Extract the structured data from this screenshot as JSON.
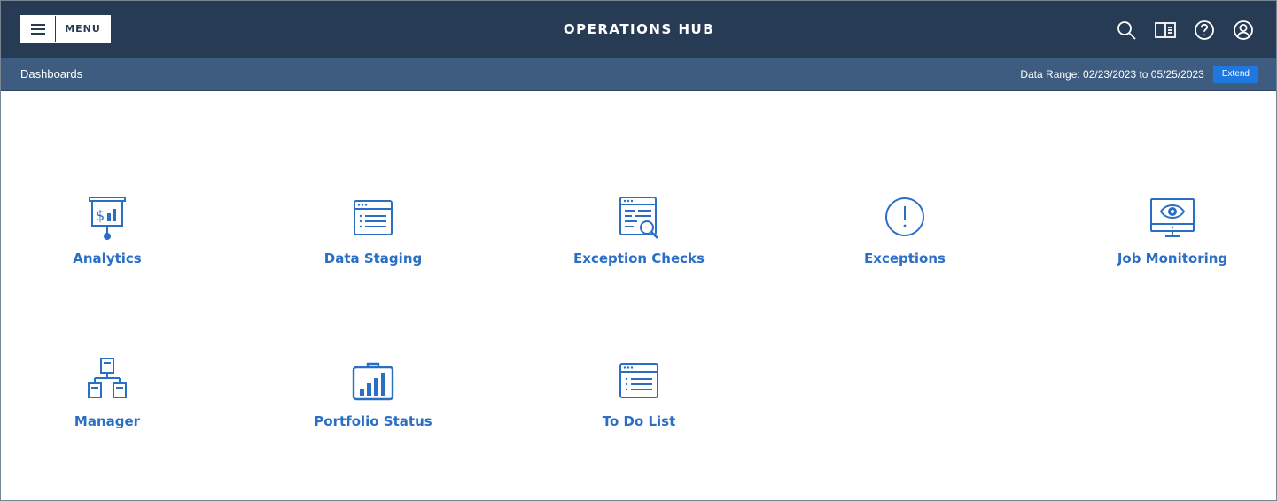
{
  "header": {
    "menu_label": "MENU",
    "title": "OPERATIONS HUB",
    "icons": [
      "search-icon",
      "book-icon",
      "help-icon",
      "user-icon"
    ]
  },
  "subheader": {
    "breadcrumb": "Dashboards",
    "date_range": "Data Range: 02/23/2023 to 05/25/2023",
    "extend_label": "Extend"
  },
  "colors": {
    "topbar": "#283b55",
    "subbar": "#3d5c80",
    "accent": "#2b6fc4",
    "extend_button": "#1f78e0"
  },
  "tiles": [
    {
      "label": "Analytics",
      "icon": "presentation-chart-icon"
    },
    {
      "label": "Data Staging",
      "icon": "browser-list-icon"
    },
    {
      "label": "Exception Checks",
      "icon": "document-search-icon"
    },
    {
      "label": "Exceptions",
      "icon": "exclamation-circle-icon"
    },
    {
      "label": "Job Monitoring",
      "icon": "monitor-eye-icon"
    },
    {
      "label": "Manager",
      "icon": "org-chart-icon"
    },
    {
      "label": "Portfolio Status",
      "icon": "briefcase-chart-icon"
    },
    {
      "label": "To Do List",
      "icon": "browser-list-icon"
    }
  ]
}
